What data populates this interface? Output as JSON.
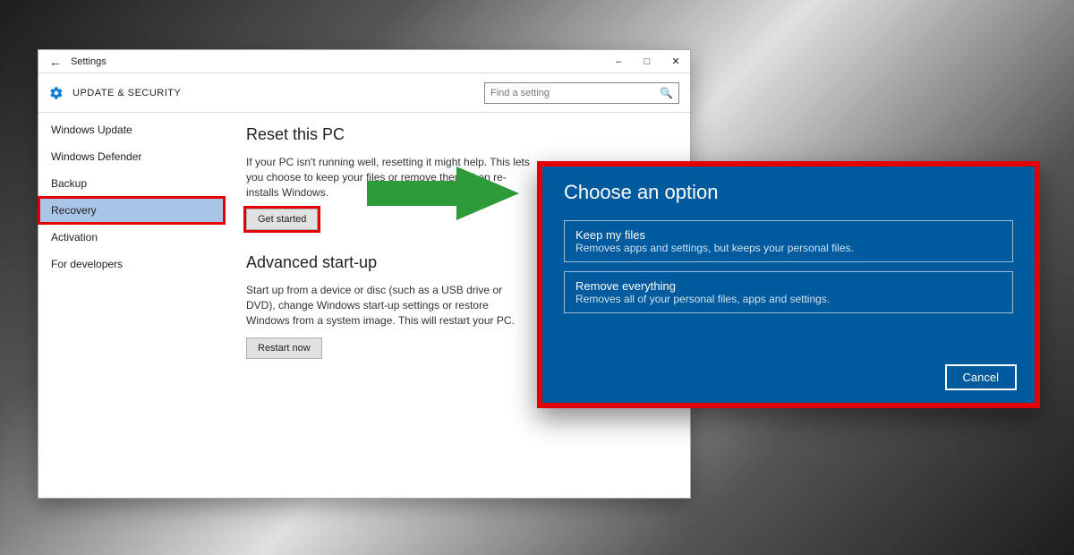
{
  "window": {
    "title": "Settings",
    "heading": "UPDATE & SECURITY",
    "search_placeholder": "Find a setting"
  },
  "sidebar": {
    "items": [
      {
        "label": "Windows Update"
      },
      {
        "label": "Windows Defender"
      },
      {
        "label": "Backup"
      },
      {
        "label": "Recovery"
      },
      {
        "label": "Activation"
      },
      {
        "label": "For developers"
      }
    ],
    "selected_index": 3
  },
  "reset": {
    "heading": "Reset this PC",
    "body": "If your PC isn't running well, resetting it might help. This lets you choose to keep your files or remove them, then re-installs Windows.",
    "button": "Get started"
  },
  "advanced": {
    "heading": "Advanced start-up",
    "body": "Start up from a device or disc (such as a USB drive or DVD), change Windows start-up settings or restore Windows from a system image. This will restart your PC.",
    "button": "Restart now"
  },
  "dialog": {
    "title": "Choose an option",
    "options": [
      {
        "title": "Keep my files",
        "desc": "Removes apps and settings, but keeps your personal files."
      },
      {
        "title": "Remove everything",
        "desc": "Removes all of your personal files, apps and settings."
      }
    ],
    "cancel": "Cancel"
  }
}
